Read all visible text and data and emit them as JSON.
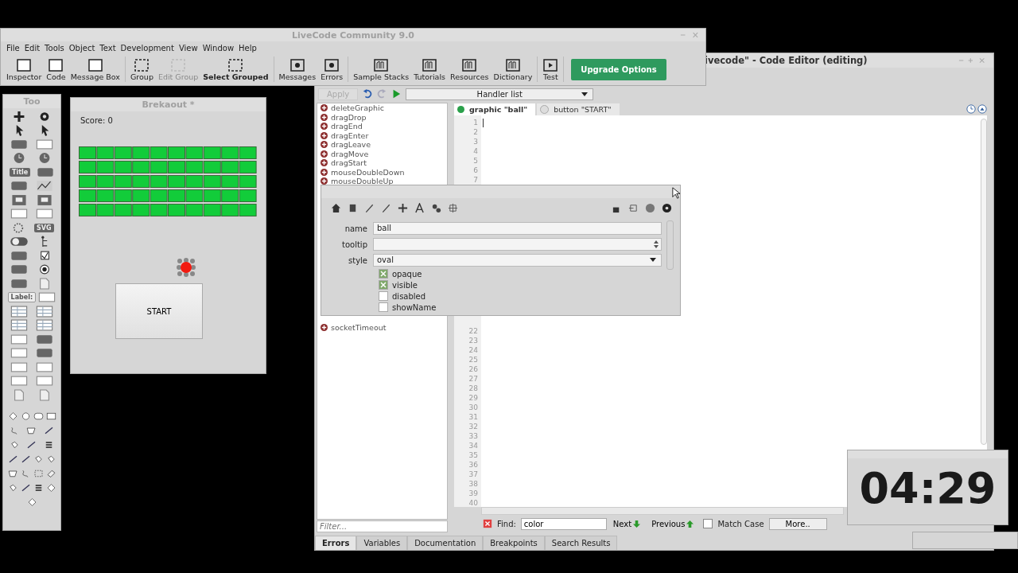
{
  "main_window": {
    "title": "LiveCode Community 9.0",
    "menu": [
      "File",
      "Edit",
      "Tools",
      "Object",
      "Text",
      "Development",
      "View",
      "Window",
      "Help"
    ],
    "toolbar_groups": [
      [
        {
          "label": "Inspector",
          "disabled": false,
          "emphasized": false
        },
        {
          "label": "Code",
          "disabled": false,
          "emphasized": false
        },
        {
          "label": "Message Box",
          "disabled": false,
          "emphasized": false
        }
      ],
      [
        {
          "label": "Group",
          "disabled": false,
          "emphasized": false
        },
        {
          "label": "Edit Group",
          "disabled": true,
          "emphasized": false
        },
        {
          "label": "Select Grouped",
          "disabled": false,
          "emphasized": true
        }
      ],
      [
        {
          "label": "Messages",
          "disabled": false,
          "emphasized": false
        },
        {
          "label": "Errors",
          "disabled": false,
          "emphasized": false
        }
      ],
      [
        {
          "label": "Sample Stacks",
          "disabled": false,
          "emphasized": false
        },
        {
          "label": "Tutorials",
          "disabled": false,
          "emphasized": false
        },
        {
          "label": "Resources",
          "disabled": false,
          "emphasized": false
        },
        {
          "label": "Dictionary",
          "disabled": false,
          "emphasized": false
        }
      ],
      [
        {
          "label": "Test",
          "disabled": false,
          "emphasized": false
        }
      ]
    ],
    "upgrade_button": "Upgrade Options"
  },
  "code_editor": {
    "title": "ivecode\" - Code Editor (editing)",
    "apply_button": "Apply",
    "handler_dropdown": "Handler list",
    "handlers": [
      "deleteGraphic",
      "dragDrop",
      "dragEnd",
      "dragEnter",
      "dragLeave",
      "dragMove",
      "dragStart",
      "mouseDoubleDown",
      "mouseDoubleUp"
    ],
    "handlers_below": [
      "socketTimeout"
    ],
    "filter_placeholder": "Filter...",
    "tabs": [
      {
        "label": "graphic \"ball\"",
        "selected": true
      },
      {
        "label": "button \"START\"",
        "selected": false
      }
    ],
    "line_number_groups": [
      [
        "1",
        "2",
        "3",
        "4",
        "5",
        "6",
        "7"
      ],
      [
        "22",
        "23",
        "24",
        "25",
        "26",
        "27",
        "28",
        "29",
        "30",
        "31",
        "32",
        "33",
        "34",
        "35",
        "36",
        "37",
        "38",
        "39",
        "40"
      ]
    ],
    "find": {
      "label": "Find:",
      "value": "color",
      "next": "Next",
      "previous": "Previous",
      "match_case": {
        "label": "Match Case",
        "checked": false
      },
      "more": "More.."
    },
    "bottom_tabs": [
      {
        "label": "Errors",
        "selected": true
      },
      {
        "label": "Variables",
        "selected": false
      },
      {
        "label": "Documentation",
        "selected": false
      },
      {
        "label": "Breakpoints",
        "selected": false
      },
      {
        "label": "Search Results",
        "selected": false
      }
    ]
  },
  "tools_palette": {
    "title": "Too",
    "title_chip": "Title",
    "svg_chip": "SVG",
    "label_chip": "Label:"
  },
  "stack_window": {
    "title": "Brekaout *",
    "score": "Score: 0",
    "start_button": "START"
  },
  "inspector": {
    "fields": [
      {
        "label": "name",
        "value": "ball",
        "kind": "text"
      },
      {
        "label": "tooltip",
        "kind": "spinner"
      },
      {
        "label": "style",
        "value": "oval",
        "kind": "dropdown"
      }
    ],
    "checkboxes": [
      {
        "label": "opaque",
        "checked": true
      },
      {
        "label": "visible",
        "checked": true
      },
      {
        "label": "disabled",
        "checked": false
      },
      {
        "label": "showName",
        "checked": false
      }
    ]
  },
  "timer": {
    "time": "04:29"
  }
}
